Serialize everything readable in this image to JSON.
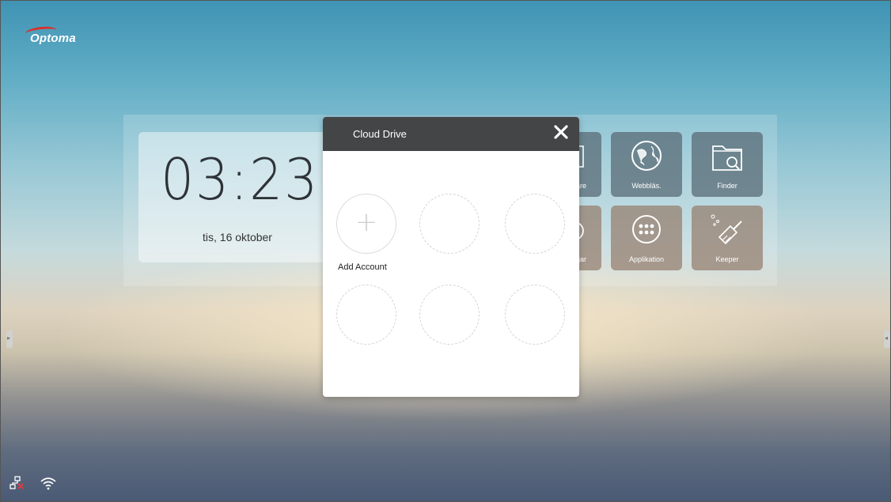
{
  "brand": {
    "logo_text": "Optoma",
    "accent_color": "#d8312a"
  },
  "clock": {
    "time": "03:23",
    "date": "tis, 16 oktober"
  },
  "tiles": [
    {
      "label": "are",
      "icon": "partial-icon"
    },
    {
      "label": "Webbläs.",
      "icon": "globe-icon"
    },
    {
      "label": "Finder",
      "icon": "folder-search-icon"
    },
    {
      "label": "gar",
      "icon": "partial-gear-icon"
    },
    {
      "label": "Applikation",
      "icon": "apps-grid-icon"
    },
    {
      "label": "Keeper",
      "icon": "broom-icon"
    }
  ],
  "dialog": {
    "title": "Cloud Drive",
    "close_icon": "close-icon",
    "add_account_label": "Add Account",
    "add_icon_glyph": "+"
  },
  "status_bar": {
    "icons": [
      "network-disconnected-icon",
      "wifi-icon"
    ]
  }
}
